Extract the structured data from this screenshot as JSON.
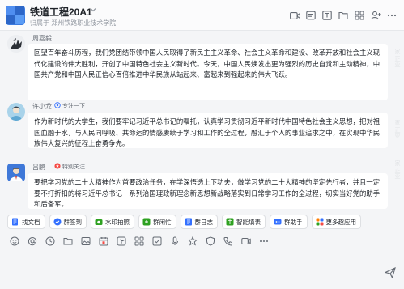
{
  "header": {
    "title": "铁道工程20A1",
    "subtitle": "归属于 郑州铁路职业技术学院",
    "icons": [
      "video-icon",
      "announcement-icon",
      "pin-icon",
      "files-icon",
      "grid-icon",
      "add-member-icon",
      "more-icon"
    ]
  },
  "messages": [
    {
      "sender": "周嘉毅",
      "tag": "",
      "text": "回望百年奋斗历程，我们党团结带领中国人民取得了新民主主义革命、社会主义革命和建设、改革开放和社会主义现代化建设的伟大胜利，开创了中国特色社会主义新时代。今天，中国人民焕发出更为强烈的历史自觉和主动精神，中国共产党和中国人民正信心百倍推进中华民族从站起来、富起来到强起来的伟大飞跃。"
    },
    {
      "sender": "许小龙",
      "tag": "专注一下",
      "text": "作为新时代的大学生，我们要牢记习近平总书记的嘱托，认真学习贯彻习近平新时代中国特色社会主义思想，把对祖国血融于水，与人民同呼吸、共命运的情感赓续于学习和工作的全过程，融汇于个人的事业追求之中，在实现中华民族伟大复兴的征程上奋勇争先。"
    },
    {
      "sender": "吕鹏",
      "tag": "特别关注",
      "text": "要把学习党的二十大精神作为首要政治任务，在学深悟透上下功夫，做学习党的二十大精神的坚定先行者，并且一定要不打折扣的将习近平总书记一系列治国理政新理念新思想新战略落实到日常学习工作的全过程，切实当好党的助手和后备军。"
    }
  ],
  "watermarks": [
    "家 正亚",
    "家 正亚",
    "家 正亚"
  ],
  "quick_actions": [
    {
      "label": "找文档",
      "icon": "doc-search-icon",
      "color": "#3370ff"
    },
    {
      "label": "群签到",
      "icon": "checkin-icon",
      "color": "#3370ff"
    },
    {
      "label": "水印拍照",
      "icon": "camera-icon",
      "color": "#2ea121"
    },
    {
      "label": "群闲忙",
      "icon": "group-status-icon",
      "color": "#2ea121"
    },
    {
      "label": "群日志",
      "icon": "log-icon",
      "color": "#3370ff"
    },
    {
      "label": "智能填表",
      "icon": "form-icon",
      "color": "#2ea121"
    },
    {
      "label": "群助手",
      "icon": "assistant-icon",
      "color": "#3370ff"
    },
    {
      "label": "更多趣应用",
      "icon": "apps-icon",
      "color": "#ff7d00"
    }
  ],
  "toolbar_icons": [
    "emoji-icon",
    "at-icon",
    "clock-icon",
    "folder-icon",
    "image-icon",
    "calendar-icon",
    "ding-icon",
    "grid-icon",
    "task-icon",
    "mic-icon",
    "star-icon",
    "shield-icon",
    "phone-icon",
    "video-call-icon",
    "more-icon"
  ],
  "colors": {
    "accent": "#3370ff",
    "bubble_bg": "#ffffff",
    "page_bg": "#f4f5f7"
  }
}
